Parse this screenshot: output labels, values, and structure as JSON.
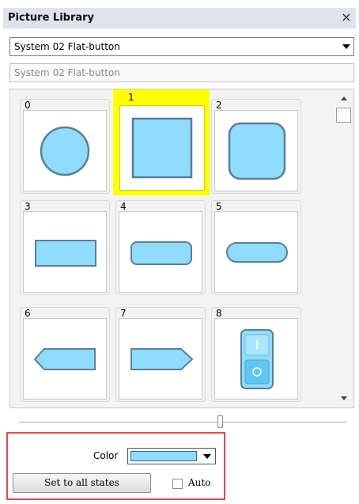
{
  "panel": {
    "title": "Picture Library",
    "close_glyph": "×"
  },
  "library_select": {
    "selected": "System 02 Flat-button"
  },
  "name_field": {
    "value": "System 02 Flat-button"
  },
  "items": [
    {
      "label": "0",
      "shape": "circle"
    },
    {
      "label": "1",
      "shape": "square",
      "selected": true
    },
    {
      "label": "2",
      "shape": "rounded-square"
    },
    {
      "label": "3",
      "shape": "rectangle"
    },
    {
      "label": "4",
      "shape": "rounded-rectangle"
    },
    {
      "label": "5",
      "shape": "pill"
    },
    {
      "label": "6",
      "shape": "hexagon-left"
    },
    {
      "label": "7",
      "shape": "pentagon-right"
    },
    {
      "label": "8",
      "shape": "toggle-switch"
    }
  ],
  "bottom": {
    "color_label": "Color",
    "color_value": "#8fdcff",
    "set_all_label": "Set to all states",
    "auto_label": "Auto",
    "auto_checked": false
  },
  "colors": {
    "shape_fill": "#8fdcff",
    "shape_stroke": "#5a7f96",
    "selection": "#ffff00",
    "highlight_box": "#e8464a"
  }
}
